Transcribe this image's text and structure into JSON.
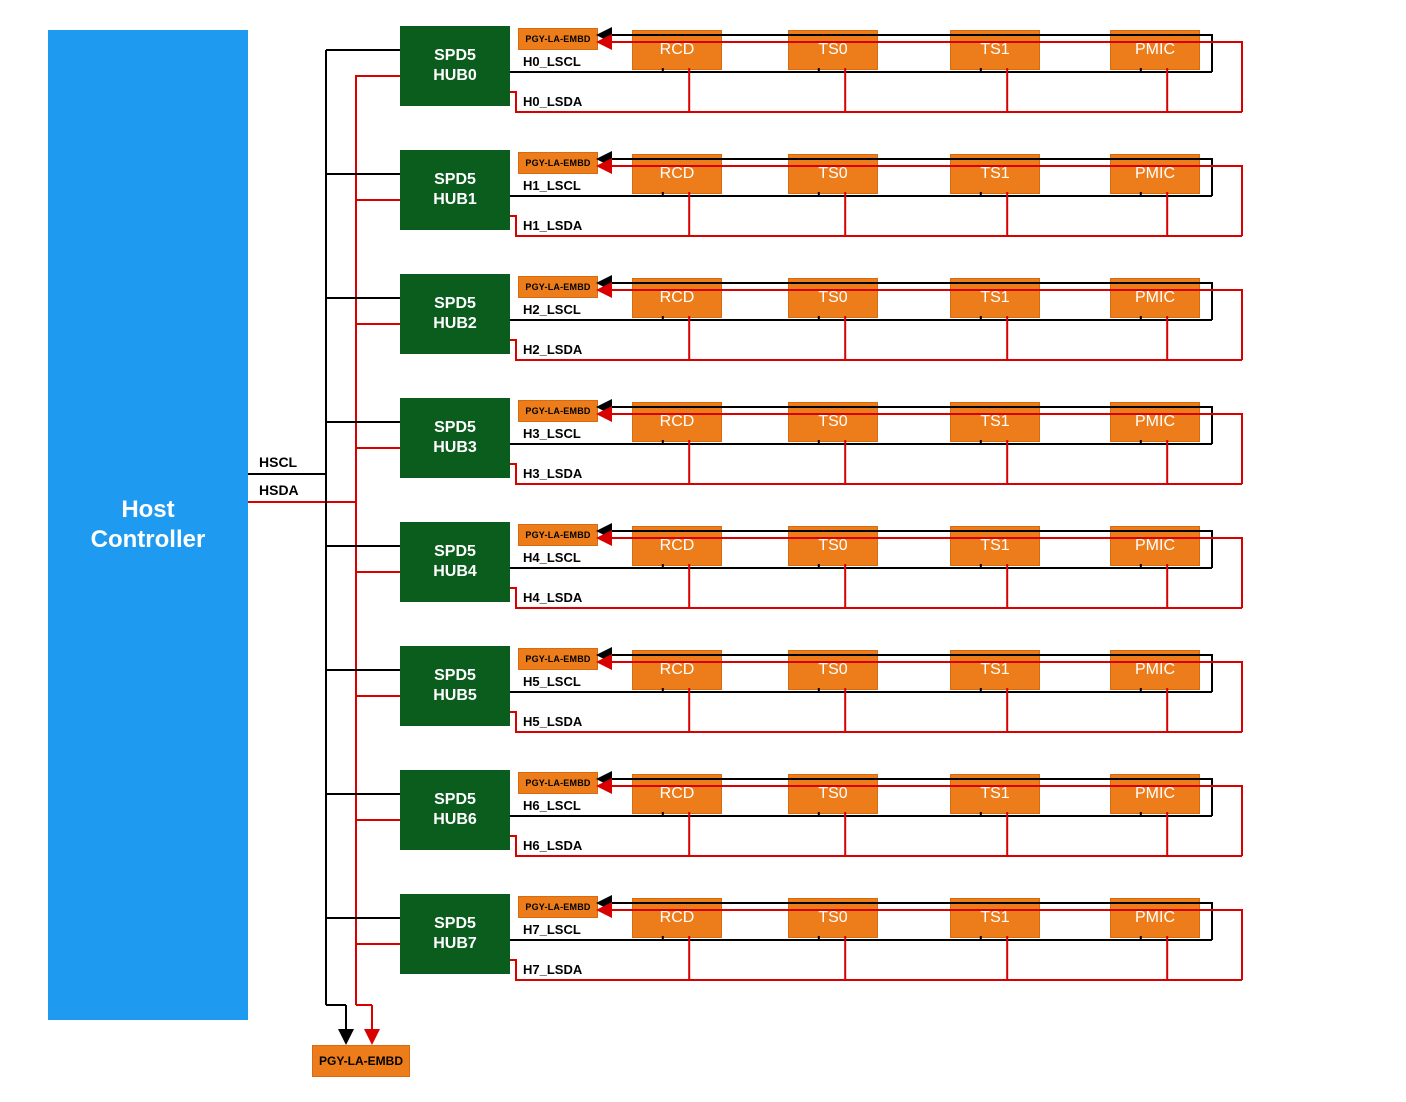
{
  "host_label": "Host\nController",
  "host_signals": {
    "hscl": "HSCL",
    "hsda": "HSDA"
  },
  "main_probe": "PGY-LA-EMBD",
  "hubs": [
    {
      "name": "SPD5\nHUB0",
      "lscl": "H0_LSCL",
      "lsda": "H0_LSDA"
    },
    {
      "name": "SPD5\nHUB1",
      "lscl": "H1_LSCL",
      "lsda": "H1_LSDA"
    },
    {
      "name": "SPD5\nHUB2",
      "lscl": "H2_LSCL",
      "lsda": "H2_LSDA"
    },
    {
      "name": "SPD5\nHUB3",
      "lscl": "H3_LSCL",
      "lsda": "H3_LSDA"
    },
    {
      "name": "SPD5\nHUB4",
      "lscl": "H4_LSCL",
      "lsda": "H4_LSDA"
    },
    {
      "name": "SPD5\nHUB5",
      "lscl": "H5_LSCL",
      "lsda": "H5_LSDA"
    },
    {
      "name": "SPD5\nHUB6",
      "lscl": "H6_LSCL",
      "lsda": "H6_LSDA"
    },
    {
      "name": "SPD5\nHUB7",
      "lscl": "H7_LSCL",
      "lsda": "H7_LSDA"
    }
  ],
  "row_devices": {
    "probe": "PGY-LA-EMBD",
    "rcd": "RCD",
    "ts0": "TS0",
    "ts1": "TS1",
    "pmic": "PMIC"
  }
}
